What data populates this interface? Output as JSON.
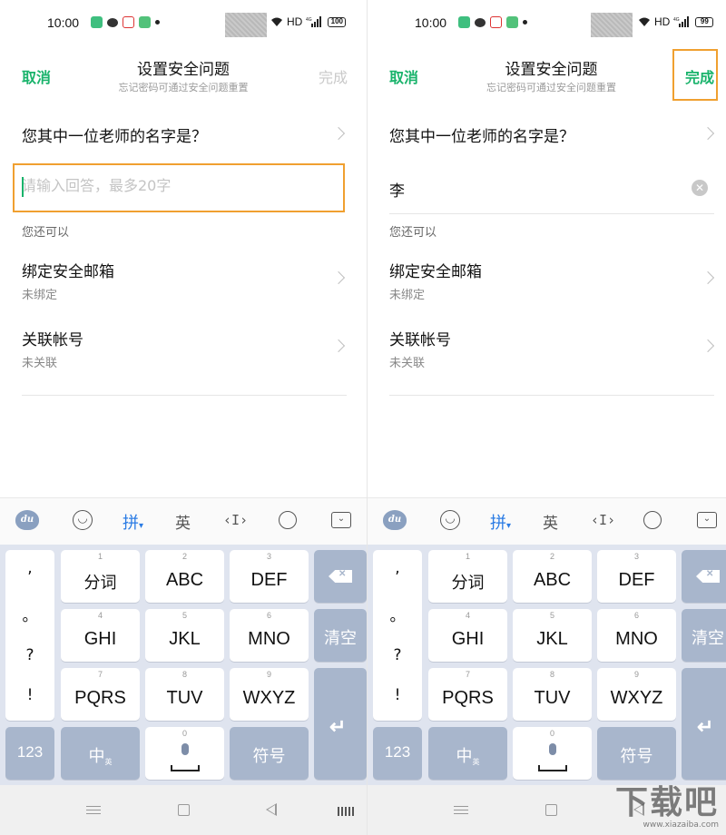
{
  "status_left": {
    "time": "10:00",
    "network": "HD",
    "battery": "100"
  },
  "status_right": {
    "time": "10:00",
    "network": "HD",
    "battery": "99"
  },
  "header": {
    "cancel": "取消",
    "title": "设置安全问题",
    "subtitle": "忘记密码可通过安全问题重置",
    "done": "完成"
  },
  "question": "您其中一位老师的名字是？",
  "answer": {
    "placeholder": "请输入回答，最多20字",
    "value_right": "李"
  },
  "also_label": "您还可以",
  "options": [
    {
      "title": "绑定安全邮箱",
      "sub": "未绑定"
    },
    {
      "title": "关联帐号",
      "sub": "未关联"
    }
  ],
  "keyboard": {
    "toolbar": {
      "logo": "du",
      "pinyin": "拼",
      "english": "英"
    },
    "punct": [
      ",",
      "。",
      "?",
      "!"
    ],
    "keys": [
      {
        "num": "1",
        "label": "分词"
      },
      {
        "num": "2",
        "label": "ABC"
      },
      {
        "num": "3",
        "label": "DEF"
      },
      {
        "num": "4",
        "label": "GHI"
      },
      {
        "num": "5",
        "label": "JKL"
      },
      {
        "num": "6",
        "label": "MNO"
      },
      {
        "num": "7",
        "label": "PQRS"
      },
      {
        "num": "8",
        "label": "TUV"
      },
      {
        "num": "9",
        "label": "WXYZ"
      }
    ],
    "clear": "清空",
    "num_key": "123",
    "lang_key": "中",
    "lang_sub": "英",
    "space_num": "0",
    "symbol_key": "符号"
  },
  "watermark": {
    "big": "下载吧",
    "small": "www.xiazaiba.com"
  },
  "colors": {
    "accent_green": "#19b36b",
    "highlight_orange": "#f0a030",
    "key_dark": "#a8b6cc"
  }
}
